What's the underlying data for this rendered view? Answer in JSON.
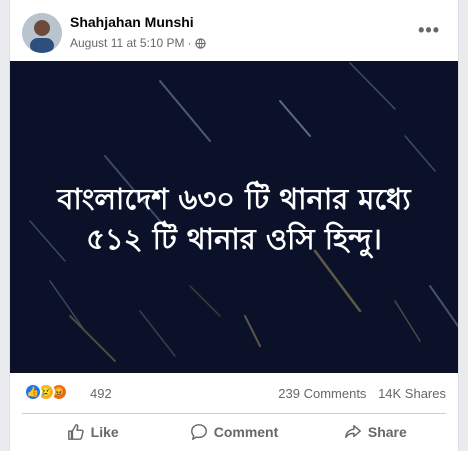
{
  "post": {
    "author": "Shahjahan Munshi",
    "timestamp": "August 11 at 5:10 PM",
    "separator": "·",
    "privacy_icon": "globe-icon",
    "more_icon": "more-options-icon",
    "more_label": "•••"
  },
  "image": {
    "line1": "বাংলাদেশ ৬৩০ টি থানার মধ্যে",
    "line2": "৫১২ টি থানার ওসি হিন্দু।",
    "background_color": "#0b1128"
  },
  "stats": {
    "reaction_icons": [
      "like-reaction-icon",
      "sad-reaction-icon",
      "angry-reaction-icon"
    ],
    "reaction_count": "492",
    "comments": "239 Comments",
    "shares": "14K Shares"
  },
  "actions": {
    "like": "Like",
    "comment": "Comment",
    "share": "Share"
  },
  "colors": {
    "accent": "#1877f2",
    "secondary_text": "#65676b"
  }
}
